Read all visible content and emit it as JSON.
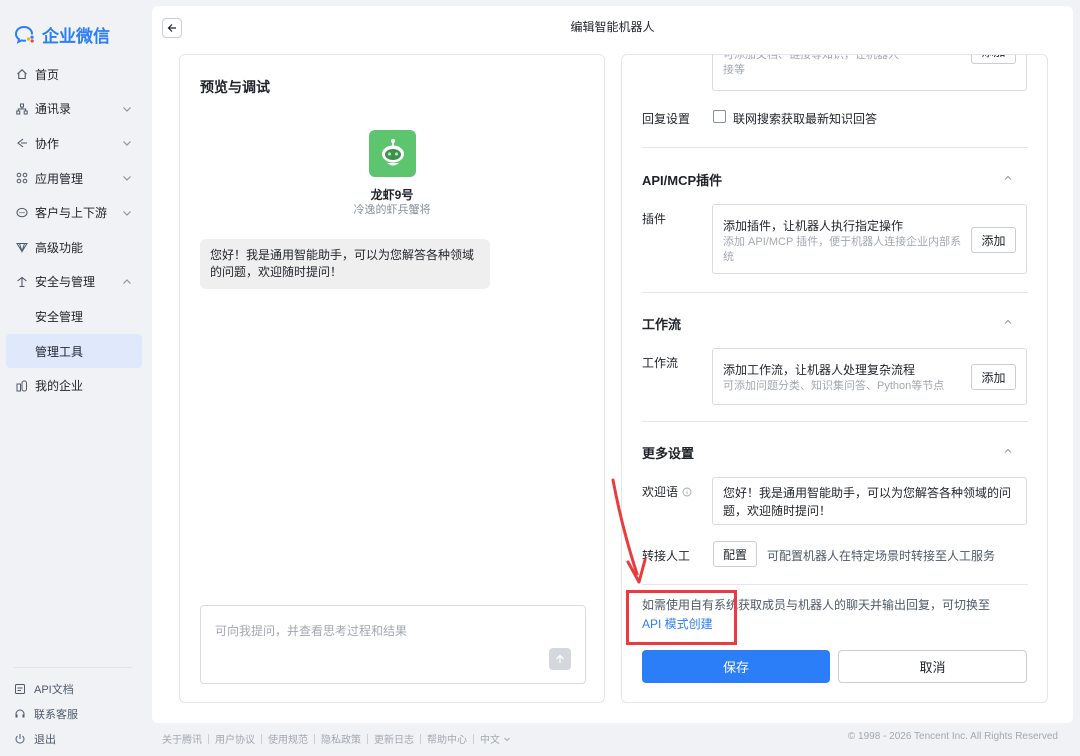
{
  "app": {
    "name": "企业微信",
    "brand_color": "#2c7ef8"
  },
  "sidebar": {
    "items": [
      {
        "label": "首页",
        "icon": "home-icon",
        "expandable": false
      },
      {
        "label": "通讯录",
        "icon": "org-tree-icon",
        "expandable": true,
        "expanded": false
      },
      {
        "label": "协作",
        "icon": "collab-icon",
        "expandable": true,
        "expanded": false
      },
      {
        "label": "应用管理",
        "icon": "grid-icon",
        "expandable": true,
        "expanded": false
      },
      {
        "label": "客户与上下游",
        "icon": "chat-bubble-icon",
        "expandable": true,
        "expanded": false
      },
      {
        "label": "高级功能",
        "icon": "diamond-icon",
        "expandable": false
      },
      {
        "label": "安全与管理",
        "icon": "shield-icon",
        "expandable": true,
        "expanded": true
      },
      {
        "label": "安全管理",
        "sub": true
      },
      {
        "label": "管理工具",
        "sub": true,
        "active": true
      },
      {
        "label": "我的企业",
        "icon": "building-icon",
        "expandable": false
      }
    ],
    "bottom": [
      {
        "label": "API文档",
        "icon": "doc-icon"
      },
      {
        "label": "联系客服",
        "icon": "headset-icon"
      },
      {
        "label": "退出",
        "icon": "power-icon"
      }
    ]
  },
  "header": {
    "title": "编辑智能机器人"
  },
  "preview": {
    "title": "预览与调试",
    "bot_name": "龙虾9号",
    "bot_subtitle": "冷逸的虾兵蟹将",
    "greeting": "您好！我是通用智能助手，可以为您解答各种领域的问题，欢迎随时提问！",
    "input_placeholder": "可向我提问，并查看思考过程和结果"
  },
  "settings": {
    "top_box_line1": "可添加文档、链接等知识，让机器人",
    "top_box_line2": "接等",
    "top_box_button": "添加",
    "reply": {
      "label": "回复设置",
      "checkbox_label": "联网搜索获取最新知识回答",
      "checked": false
    },
    "plugins": {
      "section_title": "API/MCP插件",
      "row_label": "插件",
      "box_title": "添加插件，让机器人执行指定操作",
      "box_desc": "添加 API/MCP 插件，便于机器人连接企业内部系统",
      "button": "添加"
    },
    "workflow": {
      "section_title": "工作流",
      "row_label": "工作流",
      "box_title": "添加工作流，让机器人处理复杂流程",
      "box_desc": "可添加问题分类、知识集问答、Python等节点",
      "button": "添加"
    },
    "more": {
      "section_title": "更多设置",
      "welcome_label": "欢迎语",
      "welcome_text": "您好！我是通用智能助手，可以为您解答各种领域的问题，欢迎随时提问！",
      "transfer_label": "转接人工",
      "transfer_button": "配置",
      "transfer_desc": "可配置机器人在特定场景时转接至人工服务"
    },
    "hint_text": "如需使用自有系统获取成员与机器人的聊天并输出回复，可切换至",
    "hint_link": "API 模式创建",
    "save_label": "保存",
    "cancel_label": "取消"
  },
  "footer": {
    "links": [
      "关于腾讯",
      "用户协议",
      "使用规范",
      "隐私政策",
      "更新日志",
      "帮助中心",
      "中文"
    ],
    "copyright": "© 1998 - 2026 Tencent Inc. All Rights Reserved"
  },
  "annotation": {
    "color": "#ec3b3b"
  }
}
